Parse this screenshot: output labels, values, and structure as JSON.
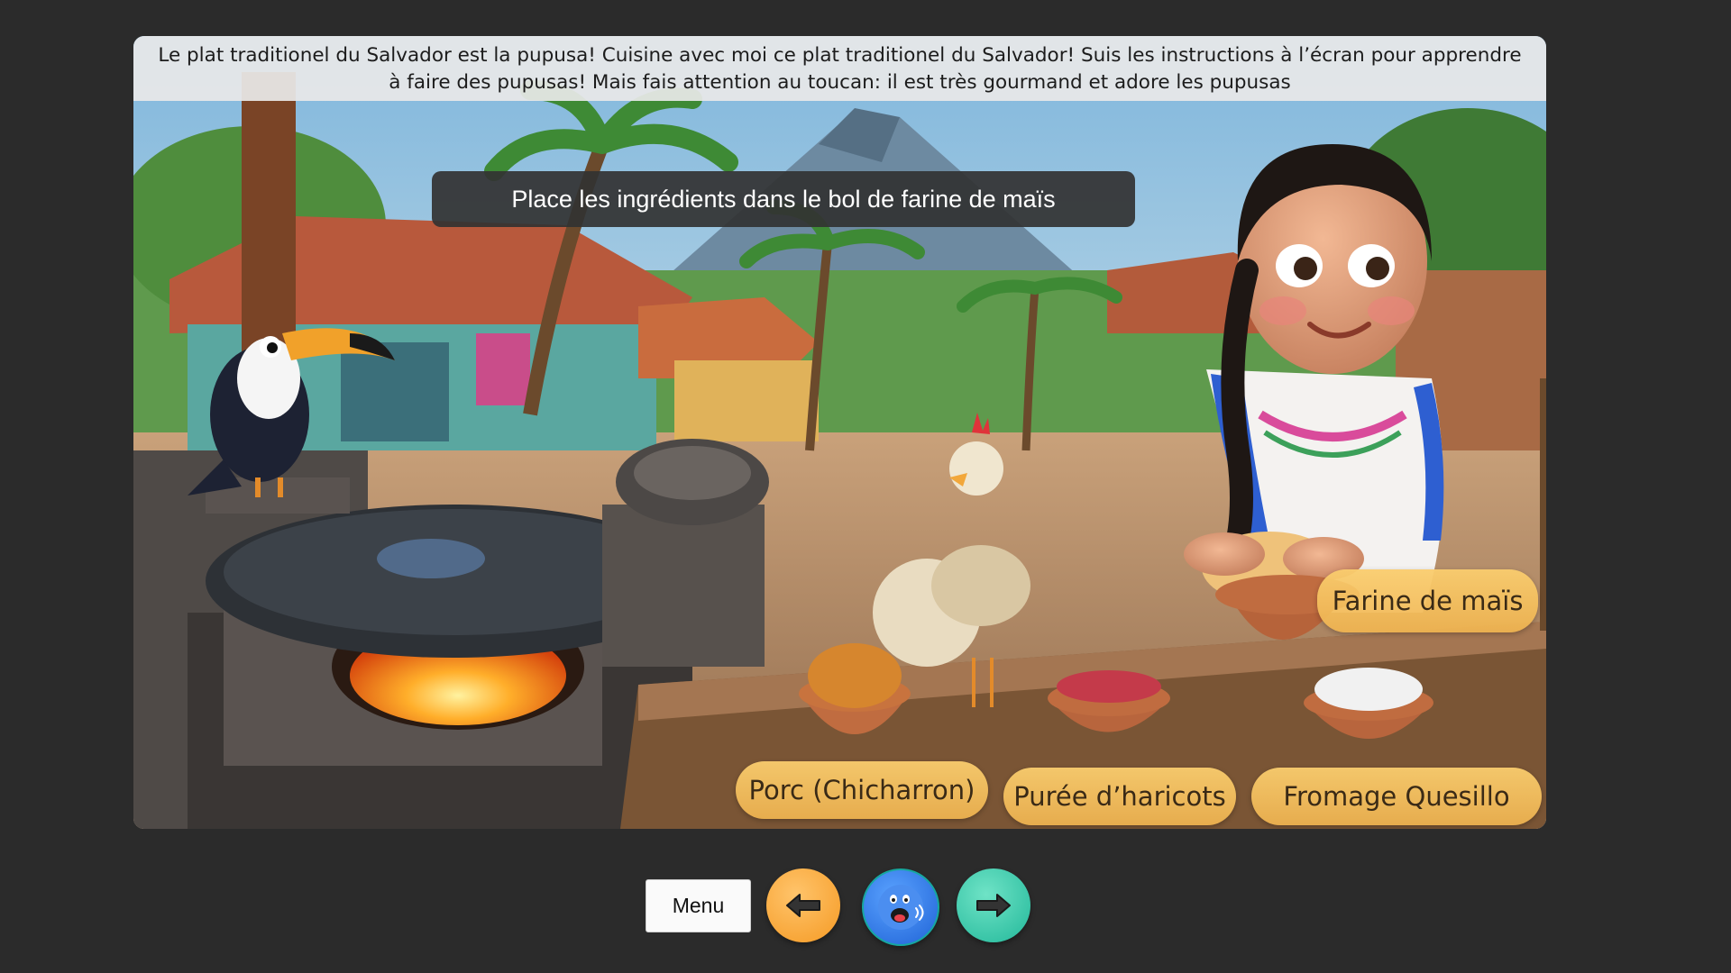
{
  "intro_text": "Le plat traditionel du Salvador est la pupusa! Cuisine avec moi ce plat traditionel du Salvador! Suis les instructions à l’écran pour apprendre à faire des pupusas! Mais fais attention au toucan: il est très gourmand et adore les pupusas",
  "instruction": "Place les ingrédients dans le bol de farine de maïs",
  "ingredients": {
    "farine": "Farine de maïs",
    "porc": "Porc (Chicharron)",
    "puree": "Purée d’haricots",
    "fromage": "Fromage Quesillo"
  },
  "controls": {
    "menu_label": "Menu",
    "prev_icon": "arrow-left-icon",
    "audio_icon": "speaking-face-icon",
    "next_icon": "arrow-right-icon"
  },
  "colors": {
    "background": "#2b2b2b",
    "label_bg": "#f4bd5c",
    "prev_button": "#f59a24",
    "audio_button": "#1f63d6",
    "next_button": "#22b89a"
  }
}
